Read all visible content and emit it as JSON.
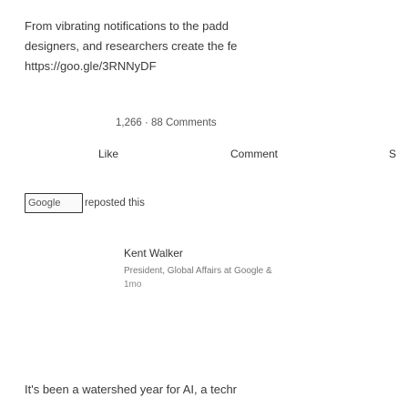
{
  "post": {
    "line1": "From vibrating notifications to the padd",
    "line2": "designers, and researchers create the fe",
    "link": "https://goo.gle/3RNNyDF"
  },
  "engagement": {
    "counts": "1,266 · 88 Comments"
  },
  "actions": {
    "like": "Like",
    "comment": "Comment",
    "share": "S"
  },
  "repost": {
    "logo_text": "Google",
    "text": "reposted this"
  },
  "author": {
    "name": "Kent Walker",
    "title": "President, Global Affairs at Google &",
    "time": "1mo"
  },
  "next_post": {
    "text": "It's been a watershed year for AI, a techr"
  }
}
